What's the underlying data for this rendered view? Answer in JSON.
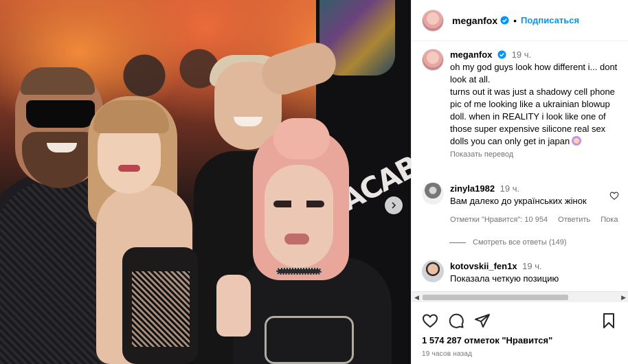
{
  "post": {
    "username": "meganfox",
    "follow_label": "Подписаться",
    "dot": "•",
    "caption_time": "19 ч.",
    "caption_text": "oh my god guys look how different i... dont look at all.\nturns out it was just a shadowy cell phone pic of me looking like a ukrainian blowup doll. when in REALITY i look like one of those super expensive silicone real sex dolls you can only get in japan",
    "caption_emoji": "woman-shrugging-emoji",
    "translate_label": "Показать перевод",
    "photo_text": "LACAB",
    "likes_text": "1 574 287 отметок \"Нравится\"",
    "posted_text": "19 часов назад"
  },
  "comments": [
    {
      "username": "zinyla1982",
      "time": "19 ч.",
      "text": "Вам далеко до українських жінок",
      "likes_label": "Отметки \"Нравится\": 10 954",
      "reply_label": "Ответить",
      "translate_label": "Пока",
      "view_replies": "Смотреть все ответы (149)"
    },
    {
      "username": "kotovskii_fen1x",
      "time": "19 ч.",
      "text": "Показала четкую позицию"
    }
  ],
  "icons": {
    "verified": "verified-badge-icon",
    "like": "heart-icon",
    "comment": "comment-icon",
    "share": "paper-plane-icon",
    "save": "bookmark-icon",
    "next": "chevron-right-icon"
  },
  "colors": {
    "link": "#0095f6",
    "verified": "#0095f6",
    "secondary_text": "#737373",
    "border": "#efefef"
  }
}
